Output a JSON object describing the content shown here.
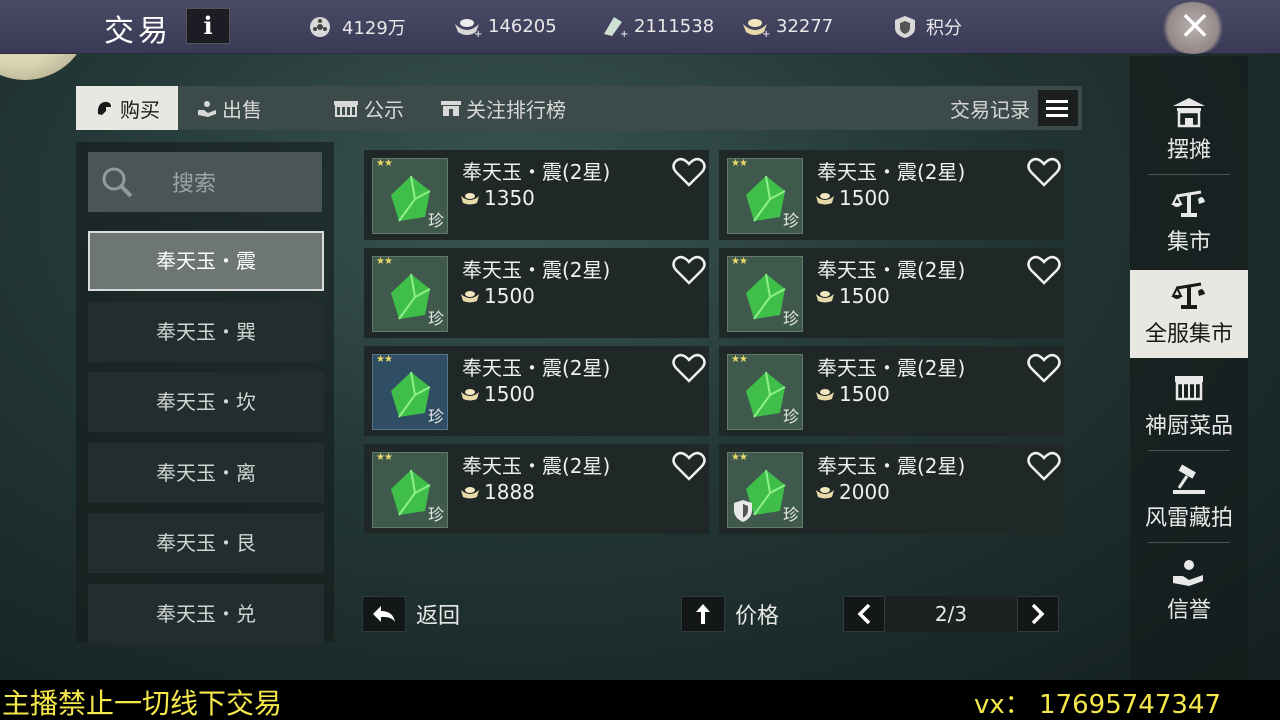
{
  "header": {
    "title": "交易",
    "info_label": "i",
    "currencies": [
      {
        "icon": "film-reel-coin-icon",
        "value": "4129万"
      },
      {
        "icon": "silver-ingot-plus-icon",
        "value": "146205"
      },
      {
        "icon": "jade-plus-icon",
        "value": "2111538"
      },
      {
        "icon": "gold-ingot-plus-icon",
        "value": "32277"
      }
    ],
    "points_label": "积分",
    "close_label": "×"
  },
  "tabs": {
    "buy": "购买",
    "sell": "出售",
    "notice": "公示",
    "ranking": "关注排行榜",
    "trade_log": "交易记录"
  },
  "search": {
    "placeholder": "搜索"
  },
  "categories": [
    {
      "label": "奉天玉・震",
      "active": true
    },
    {
      "label": "奉天玉・巽",
      "active": false
    },
    {
      "label": "奉天玉・坎",
      "active": false
    },
    {
      "label": "奉天玉・离",
      "active": false
    },
    {
      "label": "奉天玉・艮",
      "active": false
    },
    {
      "label": "奉天玉・兑",
      "active": false
    }
  ],
  "items": [
    {
      "name": "奉天玉・震(2星)",
      "price": "1350",
      "stars": "★★",
      "tag": "珍"
    },
    {
      "name": "奉天玉・震(2星)",
      "price": "1500",
      "stars": "★★",
      "tag": "珍"
    },
    {
      "name": "奉天玉・震(2星)",
      "price": "1500",
      "stars": "★★",
      "tag": "珍"
    },
    {
      "name": "奉天玉・震(2星)",
      "price": "1500",
      "stars": "★★",
      "tag": "珍"
    },
    {
      "name": "奉天玉・震(2星)",
      "price": "1500",
      "stars": "★★",
      "tag": "珍"
    },
    {
      "name": "奉天玉・震(2星)",
      "price": "1500",
      "stars": "★★",
      "tag": "珍"
    },
    {
      "name": "奉天玉・震(2星)",
      "price": "1888",
      "stars": "★★",
      "tag": "珍"
    },
    {
      "name": "奉天玉・震(2星)",
      "price": "2000",
      "stars": "★★",
      "tag": "珍"
    }
  ],
  "controls": {
    "back_label": "返回",
    "sort_label": "价格",
    "page": "2/3"
  },
  "right_nav": [
    {
      "label": "摆摊",
      "icon": "stall-pavilion-icon",
      "active": false
    },
    {
      "label": "集市",
      "icon": "scale-icon",
      "active": false
    },
    {
      "label": "全服集市",
      "icon": "scale-icon",
      "active": true
    },
    {
      "label": "神厨菜品",
      "icon": "shop-icon",
      "active": false
    },
    {
      "label": "风雷藏拍",
      "icon": "gavel-icon",
      "active": false
    },
    {
      "label": "信誉",
      "icon": "hand-reputation-icon",
      "active": false
    }
  ],
  "overlay": {
    "left_text": "主播禁止一切线下交易",
    "right_text": "vx：  17695747347"
  },
  "colors": {
    "overlay_text": "#f5e84a",
    "active_tab_bg": "#e9e7e2",
    "gem_green": "#3fbf4a"
  }
}
